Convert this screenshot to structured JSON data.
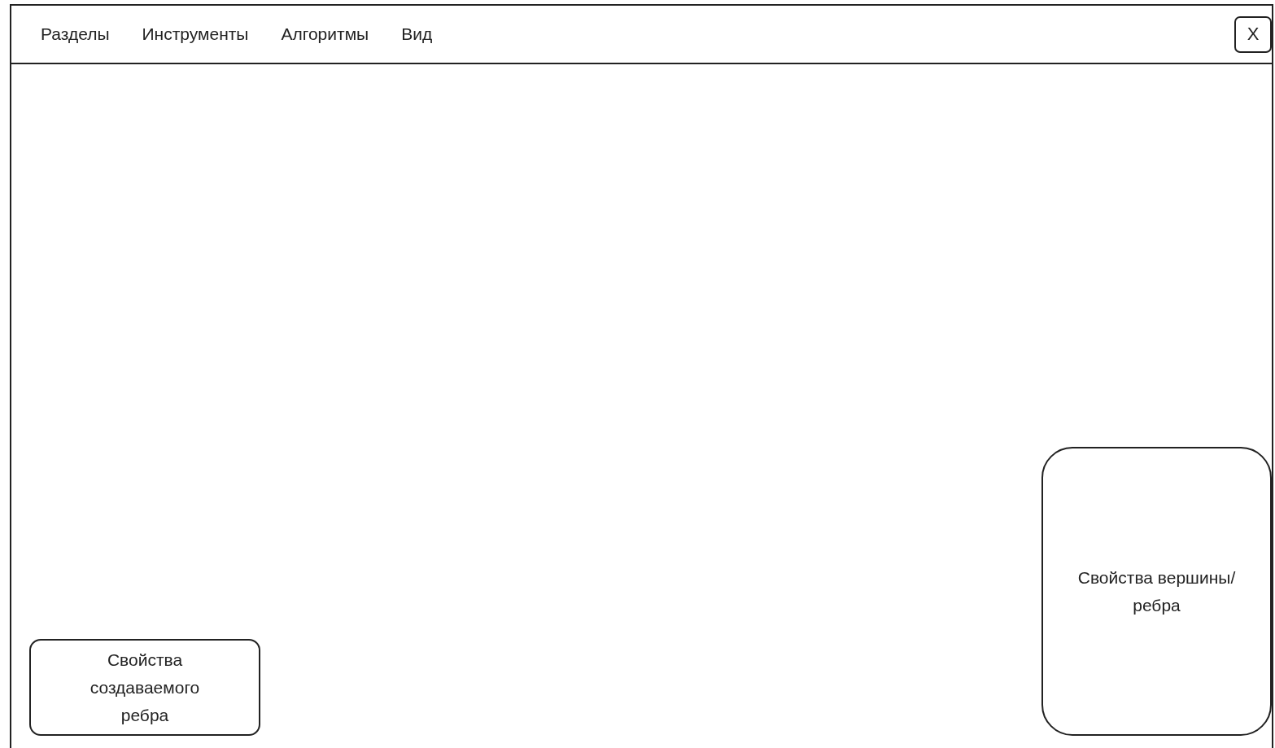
{
  "menu": [
    {
      "label": "Разделы"
    },
    {
      "label": "Инструменты"
    },
    {
      "label": "Алгоритмы"
    },
    {
      "label": "Вид"
    }
  ],
  "close_button": {
    "label": "X"
  },
  "bottom_left_panel": {
    "label": "Свойства создаваемого ребра"
  },
  "right_panel": {
    "label": "Свойства вершины/ребра"
  }
}
